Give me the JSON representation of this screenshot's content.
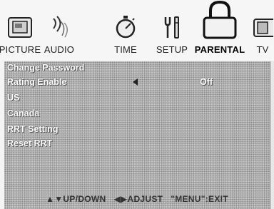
{
  "tabs": [
    {
      "label": "PICTURE",
      "icon": "tv-screen-icon"
    },
    {
      "label": "AUDIO",
      "icon": "sound-waves-icon"
    },
    {
      "label": "TIME",
      "icon": "stopwatch-icon"
    },
    {
      "label": "SETUP",
      "icon": "tools-icon"
    },
    {
      "label": "PARENTAL",
      "icon": "padlock-icon",
      "active": true
    },
    {
      "label": "TV",
      "icon": "tv-icon"
    }
  ],
  "menu": {
    "items": [
      {
        "label": "Change Password"
      },
      {
        "label": "Rating Enable",
        "value": "Off"
      },
      {
        "label": "US"
      },
      {
        "label": "Canada"
      },
      {
        "label": "RRT Setting"
      },
      {
        "label": "Reset RRT"
      }
    ]
  },
  "footer": {
    "up_down": "▲▼UP/DOWN",
    "adjust": "◀▶ADJUST",
    "exit": "\"MENU\":EXIT"
  }
}
